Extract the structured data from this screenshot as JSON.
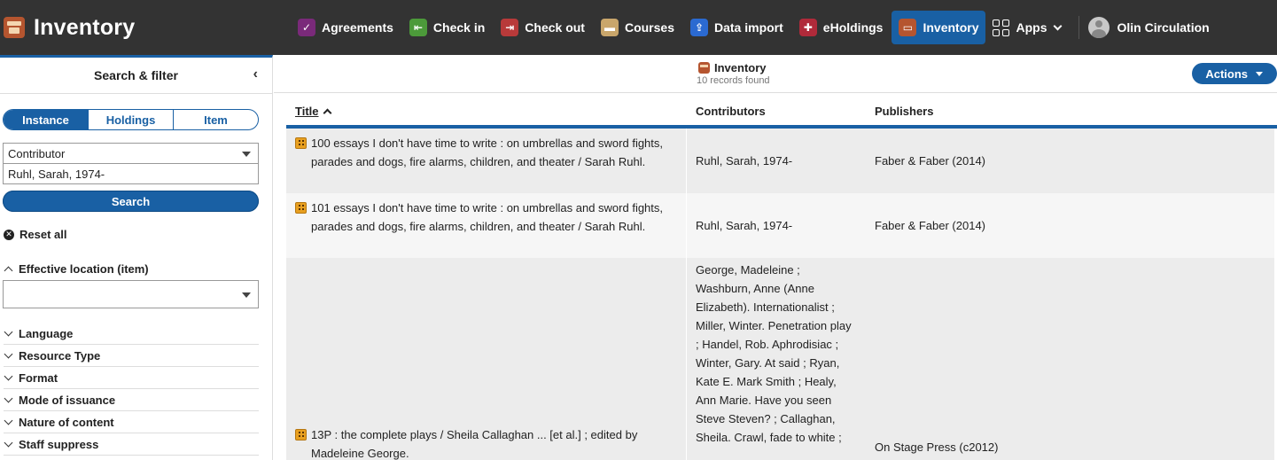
{
  "brand": {
    "title": "Inventory"
  },
  "nav": {
    "apps": [
      {
        "label": "Agreements",
        "color": "#7a2a7a",
        "glyph": "✓"
      },
      {
        "label": "Check in",
        "color": "#4c9a3a",
        "glyph": "⇤"
      },
      {
        "label": "Check out",
        "color": "#b83a3a",
        "glyph": "⇥"
      },
      {
        "label": "Courses",
        "color": "#c9a66b",
        "glyph": "▬"
      },
      {
        "label": "Data import",
        "color": "#2b6ad1",
        "glyph": "⇪"
      },
      {
        "label": "eHoldings",
        "color": "#b02a3a",
        "glyph": "✚"
      },
      {
        "label": "Inventory",
        "color": "#b5552f",
        "glyph": "▭"
      }
    ],
    "apps_menu_label": "Apps",
    "user_label": "Olin Circulation"
  },
  "filter": {
    "header": "Search & filter",
    "segments": [
      "Instance",
      "Holdings",
      "Item"
    ],
    "selected_segment": "Instance",
    "search_option": "Contributor",
    "query_value": "Ruhl, Sarah, 1974-",
    "search_button": "Search",
    "reset_label": "Reset all",
    "open_accordion": "Effective location (item)",
    "accordions": [
      "Language",
      "Resource Type",
      "Format",
      "Mode of issuance",
      "Nature of content",
      "Staff suppress"
    ]
  },
  "results": {
    "title": "Inventory",
    "count_text": "10 records found",
    "actions_label": "Actions",
    "columns": {
      "title": "Title",
      "contributors": "Contributors",
      "publishers": "Publishers"
    },
    "rows": [
      {
        "title": "100 essays I don't have time to write : on umbrellas and sword fights, parades and dogs, fire alarms, children, and theater / Sarah Ruhl.",
        "contributors": "Ruhl, Sarah, 1974-",
        "publishers": "Faber & Faber (2014)"
      },
      {
        "title": "101 essays I don't have time to write : on umbrellas and sword fights, parades and dogs, fire alarms, children, and theater / Sarah Ruhl.",
        "contributors": "Ruhl, Sarah, 1974-",
        "publishers": "Faber & Faber (2014)"
      },
      {
        "title": "13P : the complete plays / Sheila Callaghan ... [et al.] ; edited by Madeleine George.",
        "contributors": "George, Madeleine ; Washburn, Anne (Anne Elizabeth). Internationalist ; Miller, Winter. Penetration play ; Handel, Rob. Aphrodisiac ; Winter, Gary. At said ; Ryan, Kate E. Mark Smith ; Healy, Ann Marie. Have you seen Steve Steven? ; Callaghan, Sheila. Crawl, fade to white ;",
        "publishers": "On Stage Press (c2012)"
      }
    ]
  }
}
